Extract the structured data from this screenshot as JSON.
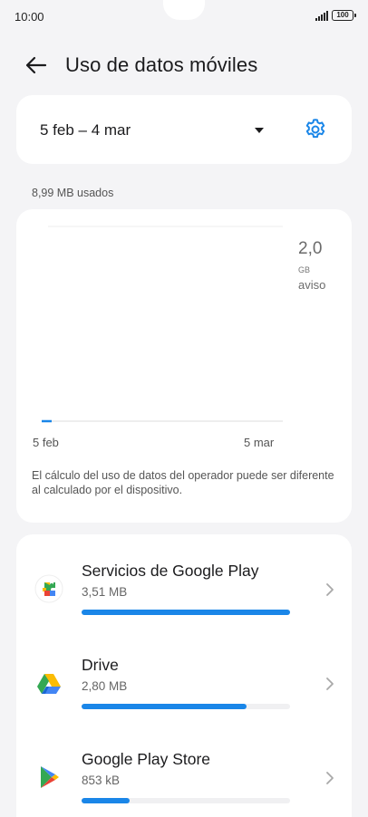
{
  "status_bar": {
    "time": "10:00",
    "battery": "100"
  },
  "header": {
    "title": "Uso de datos móviles"
  },
  "date_selector": {
    "range": "5 feb – 4 mar"
  },
  "usage": {
    "used_label": "8,99 MB usados"
  },
  "chart": {
    "limit_value": "2,0",
    "limit_unit": "GB",
    "limit_label": "aviso",
    "x_start": "5 feb",
    "x_end": "5 mar",
    "note": "El cálculo del uso de datos del operador puede ser diferente al calculado por el dispositivo."
  },
  "apps": [
    {
      "name": "Servicios de Google Play",
      "size": "3,51 MB",
      "share": 1.0,
      "icon": "google-play-services-icon"
    },
    {
      "name": "Drive",
      "size": "2,80 MB",
      "share": 0.79,
      "icon": "google-drive-icon"
    },
    {
      "name": "Google Play Store",
      "size": "853 kB",
      "share": 0.23,
      "icon": "google-play-store-icon"
    }
  ],
  "colors": {
    "accent": "#1a86e8",
    "background": "#f4f4f6",
    "card": "#ffffff"
  }
}
